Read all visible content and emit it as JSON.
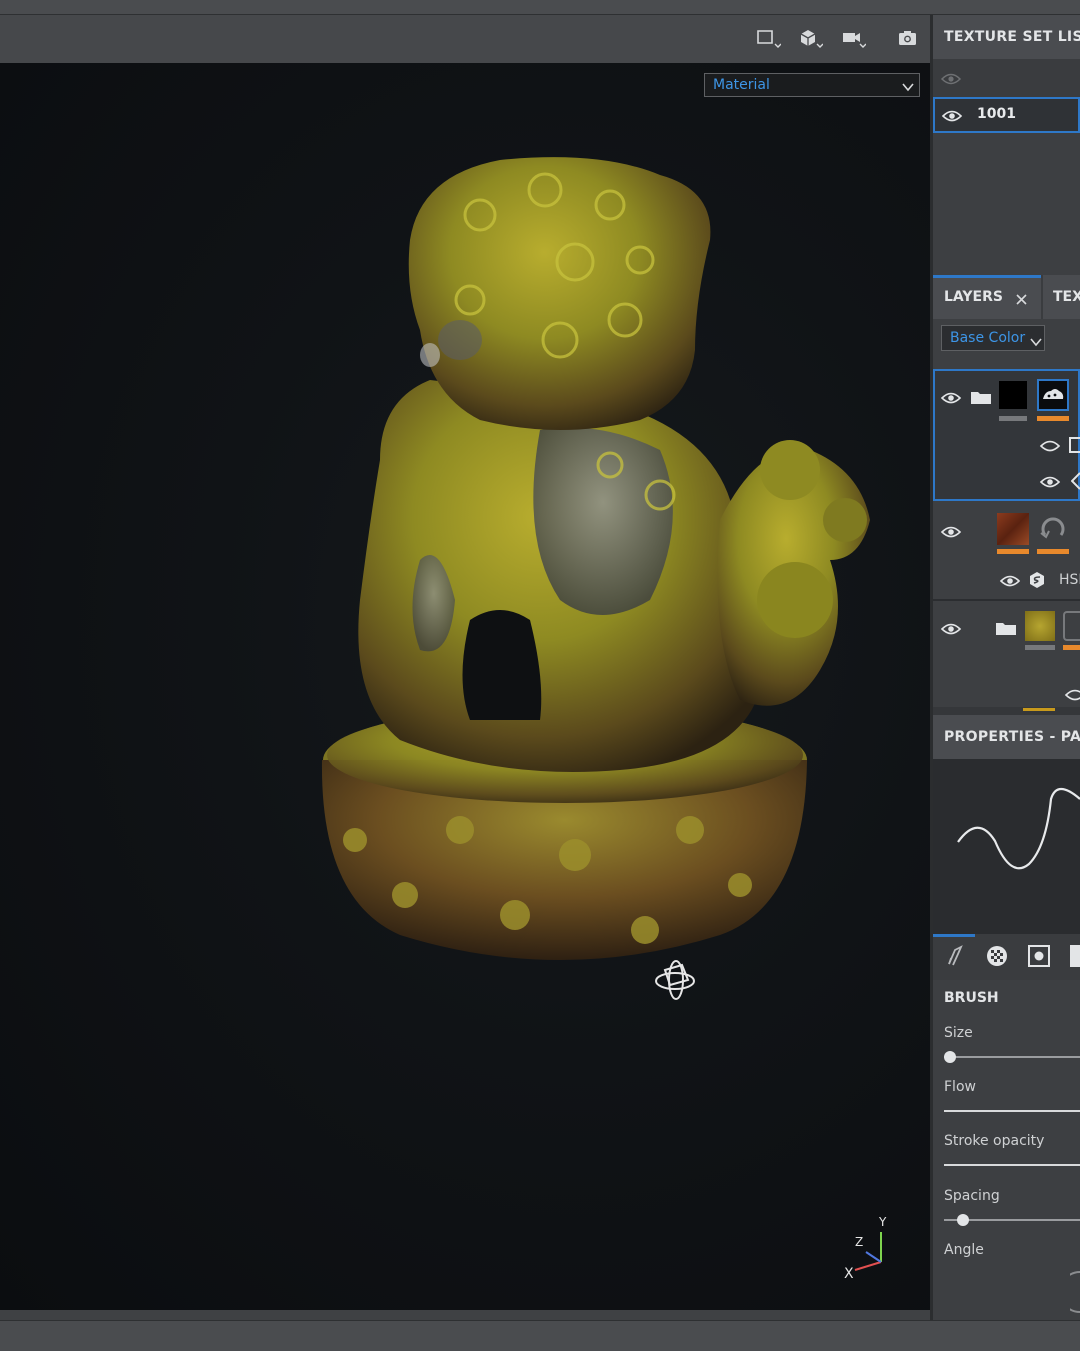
{
  "viewport": {
    "material_mode": "Material",
    "toolbar_icons": [
      "display-window-icon",
      "cube-icon",
      "camera-icon",
      "screenshot-icon"
    ],
    "axis_labels": {
      "y": "Y",
      "z": "Z",
      "x": "X"
    }
  },
  "texture_set_list": {
    "title": "TEXTURE SET LIST",
    "items": [
      {
        "name": "1001"
      }
    ]
  },
  "layers": {
    "tabs": [
      {
        "label": "LAYERS"
      },
      {
        "label": "TEX"
      }
    ],
    "channel": "Base Color",
    "effect_label": "HSL"
  },
  "properties": {
    "title": "PROPERTIES - PAI",
    "section": "BRUSH",
    "sliders": [
      {
        "label": "Size",
        "value": 0.0
      },
      {
        "label": "Flow",
        "value": 1.0
      },
      {
        "label": "Stroke opacity",
        "value": 1.0
      },
      {
        "label": "Spacing",
        "value": 0.14
      },
      {
        "label": "Angle",
        "value": null
      }
    ]
  },
  "colors": {
    "accent": "#2e78c8",
    "orange": "#e8892c",
    "link_blue": "#3d95e6"
  }
}
